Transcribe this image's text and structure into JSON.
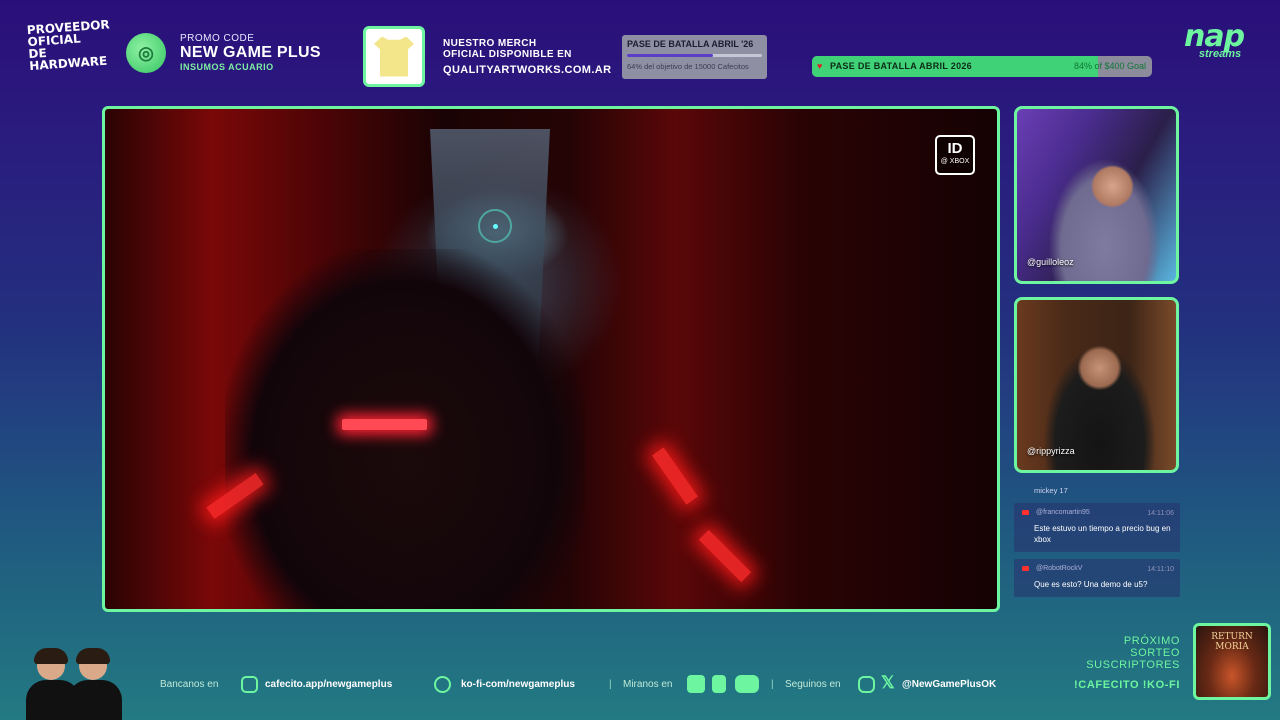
{
  "hardware_badge": "PROVEEDOR OFICIAL DE HARDWARE",
  "promo": {
    "label": "PROMO CODE",
    "code": "NEW GAME PLUS",
    "sponsor": "INSUMOS ACUARIO"
  },
  "merch": {
    "line1": "NUESTRO MERCH",
    "line2": "OFICIAL DISPONIBLE EN",
    "url": "QUALITYARTWORKS.COM.AR"
  },
  "battle_pass_small": {
    "title": "PASE DE BATALLA ABRIL '26",
    "progress": 0.64,
    "subtitle": "64% del objetivo de 15000 Cafecitos"
  },
  "battle_pass_big": {
    "title": "PASE DE BATALLA ABRIL 2026",
    "progress": 0.84,
    "goal": "84% of $400 Goal"
  },
  "logo": {
    "main": "nap",
    "sub": "streams"
  },
  "game": {
    "xbox_badge_top": "ID",
    "xbox_badge_bottom": "@ XBOX"
  },
  "cams": [
    {
      "name": "@guilloleoz"
    },
    {
      "name": "@rippyrizza"
    }
  ],
  "chat": {
    "partial": "mickey 17",
    "messages": [
      {
        "user": "@francomartin95",
        "time": "14:11:06",
        "text": "Este estuvo un tiempo a precio bug en xbox"
      },
      {
        "user": "@RobotRockV",
        "time": "14:11:10",
        "text": "Que es esto? Una demo de u5?"
      }
    ]
  },
  "bottom": {
    "bancanos": "Bancanos en",
    "cafecito": "cafecito.app/newgameplus",
    "kofi": "ko-fi-com/newgameplus",
    "miranos": "Miranos en",
    "seguinos": "Seguinos en",
    "handle": "@NewGamePlusOK",
    "sep": "|"
  },
  "sorteo": {
    "line1": "PRÓXIMO",
    "line2": "SORTEO",
    "line3": "SUSCRIPTORES",
    "cmds": "!CAFECITO  !KO-FI"
  },
  "moria": {
    "title": "RETURN MORIA"
  },
  "colors": {
    "accent": "#6df5a0",
    "bg_top": "#2a0f7a",
    "bg_bottom": "#237a82"
  }
}
